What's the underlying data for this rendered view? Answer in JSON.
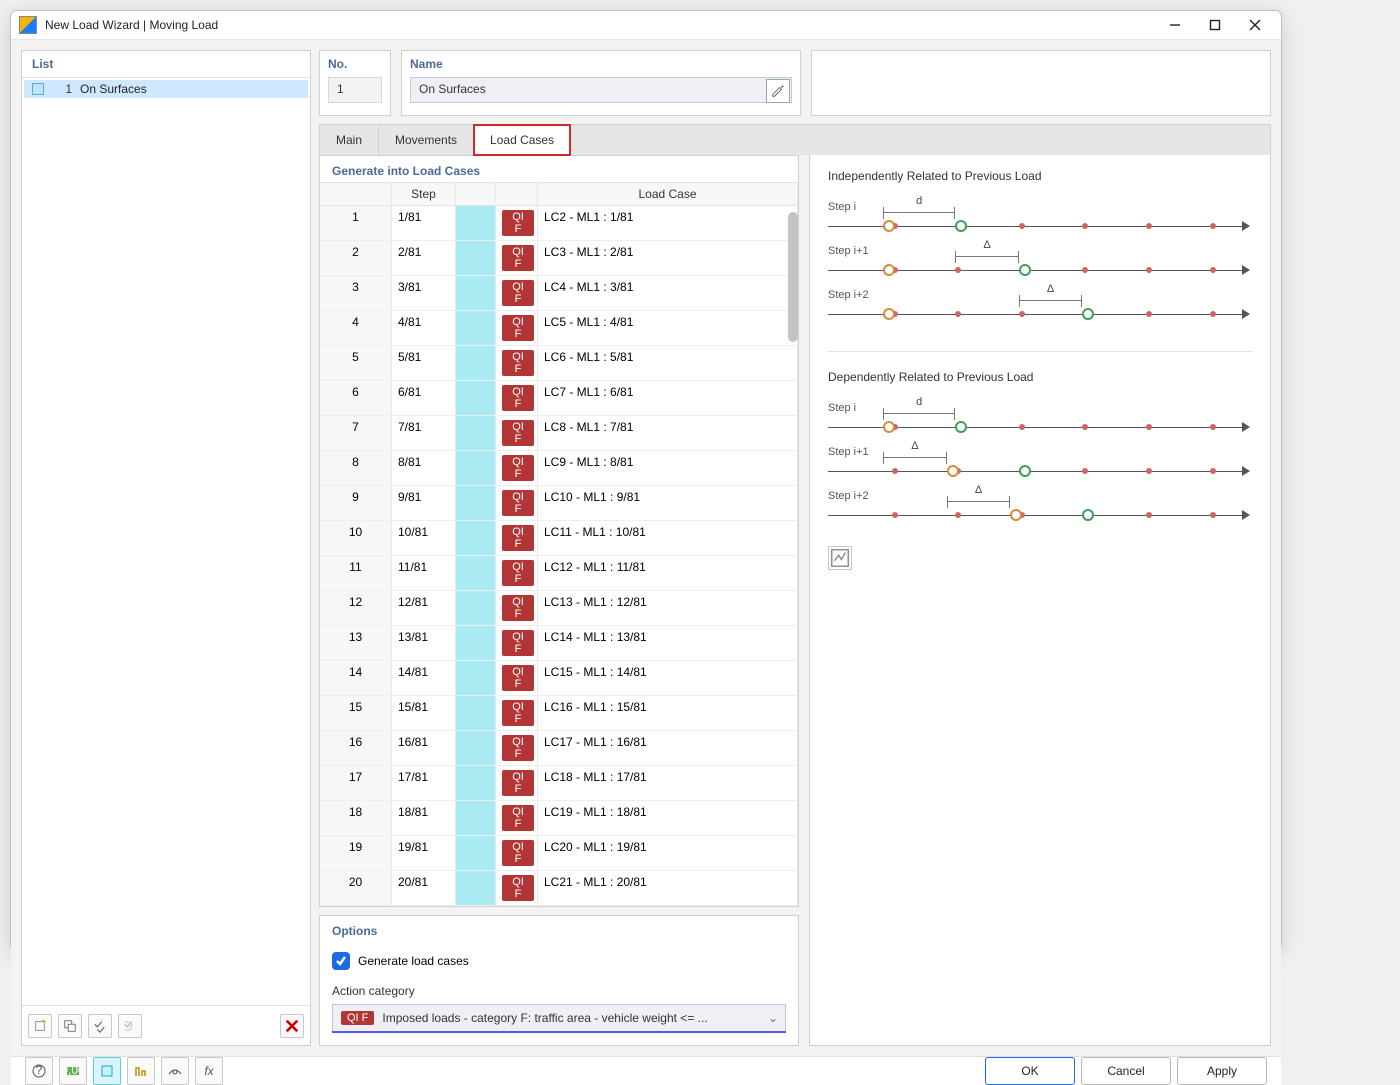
{
  "window": {
    "title": "New Load Wizard | Moving Load"
  },
  "list": {
    "header": "List",
    "items": [
      {
        "num": "1",
        "label": "On Surfaces",
        "selected": true
      }
    ]
  },
  "fields": {
    "no_label": "No.",
    "no_value": "1",
    "name_label": "Name",
    "name_value": "On Surfaces"
  },
  "tabs": {
    "main": "Main",
    "movements": "Movements",
    "load_cases": "Load Cases"
  },
  "generate": {
    "header": "Generate into Load Cases",
    "col_step": "Step",
    "col_loadcase": "Load Case",
    "badge": "QI F",
    "rows": [
      {
        "i": "1",
        "step": "1/81",
        "lc": "LC2 - ML1 : 1/81"
      },
      {
        "i": "2",
        "step": "2/81",
        "lc": "LC3 - ML1 : 2/81"
      },
      {
        "i": "3",
        "step": "3/81",
        "lc": "LC4 - ML1 : 3/81"
      },
      {
        "i": "4",
        "step": "4/81",
        "lc": "LC5 - ML1 : 4/81"
      },
      {
        "i": "5",
        "step": "5/81",
        "lc": "LC6 - ML1 : 5/81"
      },
      {
        "i": "6",
        "step": "6/81",
        "lc": "LC7 - ML1 : 6/81"
      },
      {
        "i": "7",
        "step": "7/81",
        "lc": "LC8 - ML1 : 7/81"
      },
      {
        "i": "8",
        "step": "8/81",
        "lc": "LC9 - ML1 : 8/81"
      },
      {
        "i": "9",
        "step": "9/81",
        "lc": "LC10 - ML1 : 9/81"
      },
      {
        "i": "10",
        "step": "10/81",
        "lc": "LC11 - ML1 : 10/81"
      },
      {
        "i": "11",
        "step": "11/81",
        "lc": "LC12 - ML1 : 11/81"
      },
      {
        "i": "12",
        "step": "12/81",
        "lc": "LC13 - ML1 : 12/81"
      },
      {
        "i": "13",
        "step": "13/81",
        "lc": "LC14 - ML1 : 13/81"
      },
      {
        "i": "14",
        "step": "14/81",
        "lc": "LC15 - ML1 : 14/81"
      },
      {
        "i": "15",
        "step": "15/81",
        "lc": "LC16 - ML1 : 15/81"
      },
      {
        "i": "16",
        "step": "16/81",
        "lc": "LC17 - ML1 : 16/81"
      },
      {
        "i": "17",
        "step": "17/81",
        "lc": "LC18 - ML1 : 17/81"
      },
      {
        "i": "18",
        "step": "18/81",
        "lc": "LC19 - ML1 : 18/81"
      },
      {
        "i": "19",
        "step": "19/81",
        "lc": "LC20 - ML1 : 19/81"
      },
      {
        "i": "20",
        "step": "20/81",
        "lc": "LC21 - ML1 : 20/81"
      }
    ]
  },
  "options": {
    "header": "Options",
    "gen_label": "Generate load cases",
    "action_label": "Action category",
    "action_badge": "QI F",
    "action_value": "Imposed loads - category F: traffic area - vehicle weight <= ..."
  },
  "diagrams": {
    "indep_title": "Independently Related to Previous Load",
    "dep_title": "Dependently Related to Previous Load",
    "step_i": "Step i",
    "step_i1": "Step i+1",
    "step_i2": "Step i+2",
    "d": "d",
    "delta": "Δ"
  },
  "footer": {
    "ok": "OK",
    "cancel": "Cancel",
    "apply": "Apply"
  }
}
